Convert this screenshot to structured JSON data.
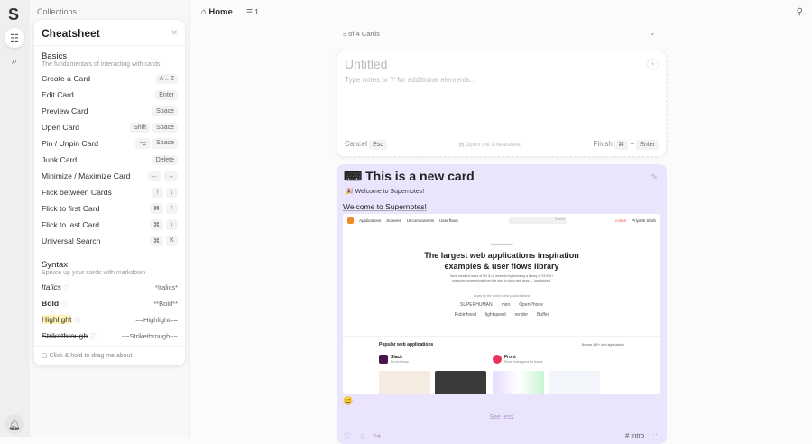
{
  "rail": {
    "logo": "S",
    "items": [
      "collections-icon",
      "search-icon"
    ],
    "bottom": "bell-icon"
  },
  "collections": {
    "title": "Collections"
  },
  "cheatsheet": {
    "title": "Cheatsheet",
    "basics": {
      "title": "Basics",
      "subtitle": "The fundamentals of interacting with cards",
      "rows": [
        {
          "label": "Create a Card",
          "keys": [
            "A .. Z"
          ]
        },
        {
          "label": "Edit Card",
          "keys": [
            "Enter"
          ]
        },
        {
          "label": "Preview Card",
          "keys": [
            "Space"
          ]
        },
        {
          "label": "Open Card",
          "keys": [
            "Shift",
            "Space"
          ]
        },
        {
          "label": "Pin / Unpin Card",
          "keys": [
            "⌥",
            "Space"
          ]
        },
        {
          "label": "Junk Card",
          "keys": [
            "Delete"
          ]
        },
        {
          "label": "Minimize / Maximize Card",
          "keys": [
            "←",
            "→"
          ]
        },
        {
          "label": "Flick between Cards",
          "keys": [
            "↑",
            "↓"
          ]
        },
        {
          "label": "Flick to first Card",
          "keys": [
            "⌘",
            "↑"
          ]
        },
        {
          "label": "Flick to last Card",
          "keys": [
            "⌘",
            "↓"
          ]
        },
        {
          "label": "Universal Search",
          "keys": [
            "⌘",
            "K"
          ]
        }
      ]
    },
    "syntax": {
      "title": "Syntax",
      "subtitle": "Spruce up your cards with markdown",
      "rows": [
        {
          "label": "Italics",
          "syntax": "*Italics*"
        },
        {
          "label": "Bold",
          "syntax": "**Bold**"
        },
        {
          "label": "Highlight",
          "syntax": "==Highlight=="
        },
        {
          "label": "Strikethrough",
          "syntax": "~~Strikethrough~~"
        }
      ]
    },
    "footer": "Click & hold to drag me about"
  },
  "topbar": {
    "home": "Home",
    "filter_count": "1"
  },
  "list": {
    "count": "3 of 4 Cards"
  },
  "new_card": {
    "title_placeholder": "Untitled",
    "body_placeholder": "Type notes or '/' for additional elements...",
    "cancel": "Cancel",
    "cancel_key": "Esc",
    "cheatsheet_link": "Open the Cheatsheet",
    "finish": "Finish",
    "finish_keys": [
      "⌘",
      "+",
      "Enter"
    ]
  },
  "card": {
    "emoji": "⌨",
    "title": "This is a new card",
    "subtitle": "🎉 Welcome to Supernotes!",
    "link": "Welcome to Supernotes!",
    "reaction": "😀",
    "see_less": "See less",
    "tag": "# intro",
    "embed": {
      "nav": [
        "Applications",
        "Screens",
        "UI components",
        "User flows"
      ],
      "search": "Search",
      "user_action": "Action",
      "user": "Priyank Shah",
      "tag": "Updated weekly",
      "headline1": "The largest web applications inspiration",
      "headline2": "examples & user flows library",
      "desc1": "Save hundred hours of UX & UI research by browsing a library of 33,000+",
      "desc2": "organized screenshots from the best in class web apps — handpicked.",
      "loved": "Loved by the world's best product teams",
      "brands1": [
        "SUPERHUMAN",
        "miro",
        "OpenPhone"
      ],
      "brands2": [
        "Robinhood",
        "lightspeed",
        "render",
        "Buffer"
      ],
      "popular": "Popular web applications",
      "browse": "Browse 490+ web applications",
      "apps": [
        {
          "name": "Slack",
          "desc": "Be less busy",
          "color": "#4a154b"
        },
        {
          "name": "Front",
          "desc": "Email redesigned for teams",
          "color": "#e8335a"
        }
      ]
    }
  }
}
